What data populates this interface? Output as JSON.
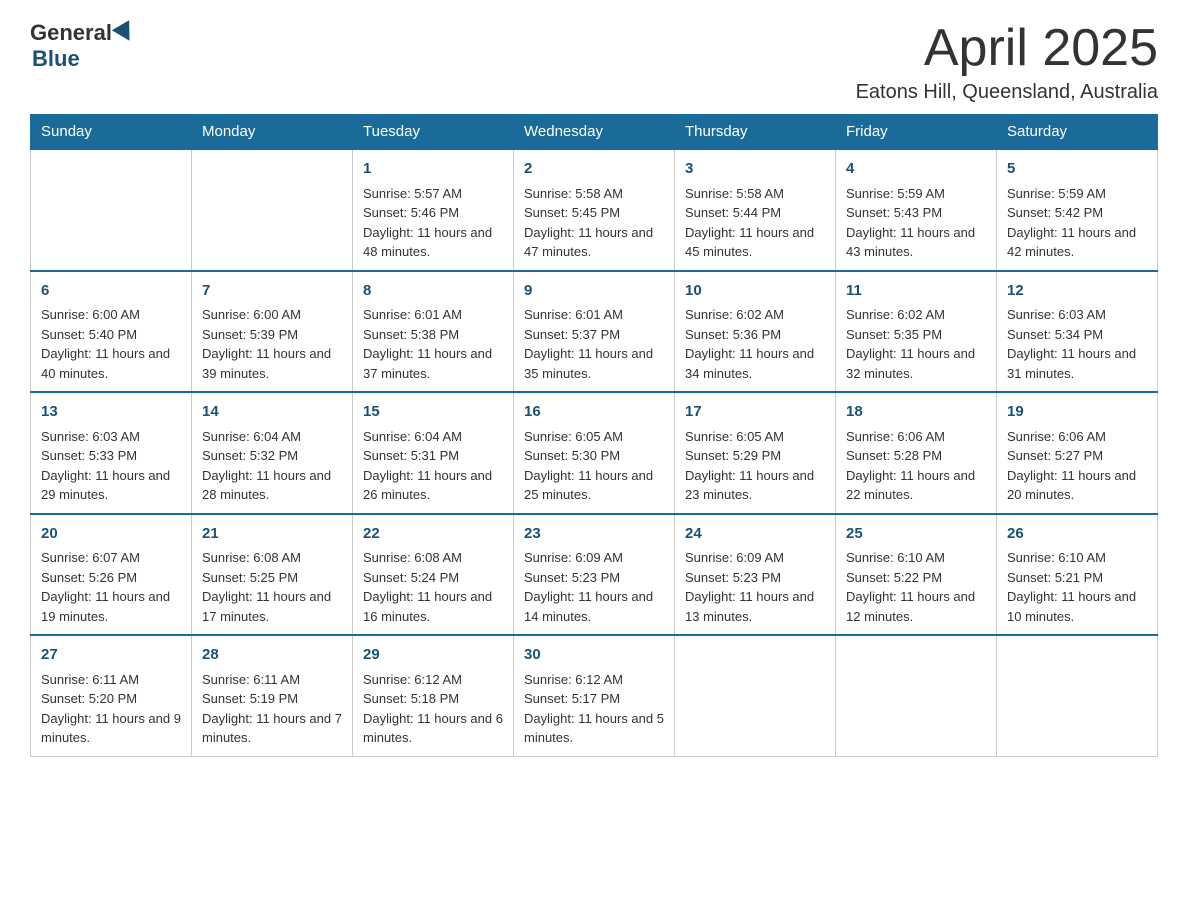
{
  "header": {
    "logo": {
      "general": "General",
      "blue": "Blue"
    },
    "title": "April 2025",
    "subtitle": "Eatons Hill, Queensland, Australia"
  },
  "calendar": {
    "days_of_week": [
      "Sunday",
      "Monday",
      "Tuesday",
      "Wednesday",
      "Thursday",
      "Friday",
      "Saturday"
    ],
    "weeks": [
      [
        {
          "day": "",
          "info": ""
        },
        {
          "day": "",
          "info": ""
        },
        {
          "day": "1",
          "info": "Sunrise: 5:57 AM\nSunset: 5:46 PM\nDaylight: 11 hours and 48 minutes."
        },
        {
          "day": "2",
          "info": "Sunrise: 5:58 AM\nSunset: 5:45 PM\nDaylight: 11 hours and 47 minutes."
        },
        {
          "day": "3",
          "info": "Sunrise: 5:58 AM\nSunset: 5:44 PM\nDaylight: 11 hours and 45 minutes."
        },
        {
          "day": "4",
          "info": "Sunrise: 5:59 AM\nSunset: 5:43 PM\nDaylight: 11 hours and 43 minutes."
        },
        {
          "day": "5",
          "info": "Sunrise: 5:59 AM\nSunset: 5:42 PM\nDaylight: 11 hours and 42 minutes."
        }
      ],
      [
        {
          "day": "6",
          "info": "Sunrise: 6:00 AM\nSunset: 5:40 PM\nDaylight: 11 hours and 40 minutes."
        },
        {
          "day": "7",
          "info": "Sunrise: 6:00 AM\nSunset: 5:39 PM\nDaylight: 11 hours and 39 minutes."
        },
        {
          "day": "8",
          "info": "Sunrise: 6:01 AM\nSunset: 5:38 PM\nDaylight: 11 hours and 37 minutes."
        },
        {
          "day": "9",
          "info": "Sunrise: 6:01 AM\nSunset: 5:37 PM\nDaylight: 11 hours and 35 minutes."
        },
        {
          "day": "10",
          "info": "Sunrise: 6:02 AM\nSunset: 5:36 PM\nDaylight: 11 hours and 34 minutes."
        },
        {
          "day": "11",
          "info": "Sunrise: 6:02 AM\nSunset: 5:35 PM\nDaylight: 11 hours and 32 minutes."
        },
        {
          "day": "12",
          "info": "Sunrise: 6:03 AM\nSunset: 5:34 PM\nDaylight: 11 hours and 31 minutes."
        }
      ],
      [
        {
          "day": "13",
          "info": "Sunrise: 6:03 AM\nSunset: 5:33 PM\nDaylight: 11 hours and 29 minutes."
        },
        {
          "day": "14",
          "info": "Sunrise: 6:04 AM\nSunset: 5:32 PM\nDaylight: 11 hours and 28 minutes."
        },
        {
          "day": "15",
          "info": "Sunrise: 6:04 AM\nSunset: 5:31 PM\nDaylight: 11 hours and 26 minutes."
        },
        {
          "day": "16",
          "info": "Sunrise: 6:05 AM\nSunset: 5:30 PM\nDaylight: 11 hours and 25 minutes."
        },
        {
          "day": "17",
          "info": "Sunrise: 6:05 AM\nSunset: 5:29 PM\nDaylight: 11 hours and 23 minutes."
        },
        {
          "day": "18",
          "info": "Sunrise: 6:06 AM\nSunset: 5:28 PM\nDaylight: 11 hours and 22 minutes."
        },
        {
          "day": "19",
          "info": "Sunrise: 6:06 AM\nSunset: 5:27 PM\nDaylight: 11 hours and 20 minutes."
        }
      ],
      [
        {
          "day": "20",
          "info": "Sunrise: 6:07 AM\nSunset: 5:26 PM\nDaylight: 11 hours and 19 minutes."
        },
        {
          "day": "21",
          "info": "Sunrise: 6:08 AM\nSunset: 5:25 PM\nDaylight: 11 hours and 17 minutes."
        },
        {
          "day": "22",
          "info": "Sunrise: 6:08 AM\nSunset: 5:24 PM\nDaylight: 11 hours and 16 minutes."
        },
        {
          "day": "23",
          "info": "Sunrise: 6:09 AM\nSunset: 5:23 PM\nDaylight: 11 hours and 14 minutes."
        },
        {
          "day": "24",
          "info": "Sunrise: 6:09 AM\nSunset: 5:23 PM\nDaylight: 11 hours and 13 minutes."
        },
        {
          "day": "25",
          "info": "Sunrise: 6:10 AM\nSunset: 5:22 PM\nDaylight: 11 hours and 12 minutes."
        },
        {
          "day": "26",
          "info": "Sunrise: 6:10 AM\nSunset: 5:21 PM\nDaylight: 11 hours and 10 minutes."
        }
      ],
      [
        {
          "day": "27",
          "info": "Sunrise: 6:11 AM\nSunset: 5:20 PM\nDaylight: 11 hours and 9 minutes."
        },
        {
          "day": "28",
          "info": "Sunrise: 6:11 AM\nSunset: 5:19 PM\nDaylight: 11 hours and 7 minutes."
        },
        {
          "day": "29",
          "info": "Sunrise: 6:12 AM\nSunset: 5:18 PM\nDaylight: 11 hours and 6 minutes."
        },
        {
          "day": "30",
          "info": "Sunrise: 6:12 AM\nSunset: 5:17 PM\nDaylight: 11 hours and 5 minutes."
        },
        {
          "day": "",
          "info": ""
        },
        {
          "day": "",
          "info": ""
        },
        {
          "day": "",
          "info": ""
        }
      ]
    ]
  }
}
